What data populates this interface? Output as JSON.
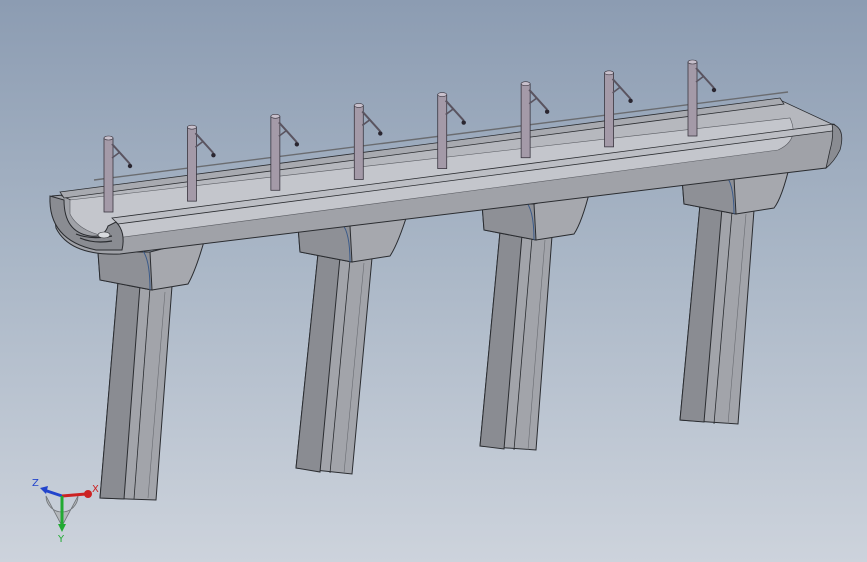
{
  "viewport": {
    "background_top": "#8c9cb2",
    "background_bottom": "#cdd3dc"
  },
  "model": {
    "concrete_color": "#9c9ea4",
    "concrete_shade": "#7c7e84",
    "concrete_light": "#c4c6cc",
    "edge_color": "#2a2c30",
    "pole_color": "#a49aa8",
    "pole_count": 8,
    "pier_count": 4
  },
  "triad": {
    "x_label": "X",
    "y_label": "Y",
    "z_label": "Z",
    "x_color": "#cc2222",
    "y_color": "#22aa33",
    "z_color": "#2244cc"
  }
}
